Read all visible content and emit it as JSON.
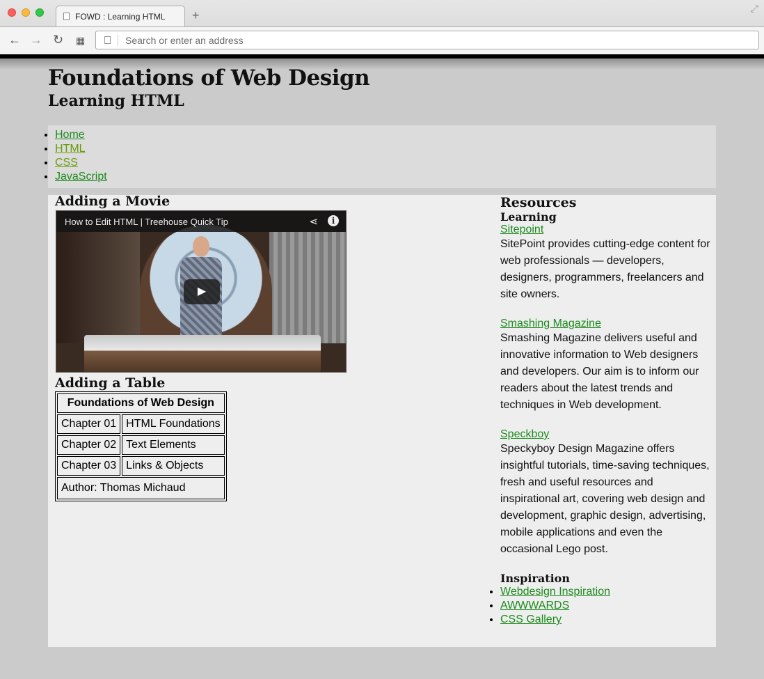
{
  "browser": {
    "tab_title": "FOWD : Learning HTML",
    "new_tab": "+",
    "address_placeholder": "Search or enter an address"
  },
  "site": {
    "title": "Foundations of Web Design",
    "subtitle": "Learning HTML"
  },
  "nav": {
    "items": [
      "Home",
      "HTML",
      "CSS",
      "JavaScript"
    ]
  },
  "main": {
    "movie_heading": "Adding a Movie",
    "video_title": "How to Edit HTML | Treehouse Quick Tip",
    "table_heading": "Adding a Table",
    "table": {
      "caption": "Foundations of Web Design",
      "rows": [
        [
          "Chapter 01",
          "HTML Foundations"
        ],
        [
          "Chapter 02",
          "Text Elements"
        ],
        [
          "Chapter 03",
          "Links & Objects"
        ]
      ],
      "footer": "Author: Thomas Michaud"
    }
  },
  "resources": {
    "heading": "Resources",
    "learning_heading": "Learning",
    "learning": [
      {
        "name": "Sitepoint",
        "desc": "SitePoint provides cutting-edge content for web professionals — developers, designers, programmers, freelancers and site owners."
      },
      {
        "name": "Smashing Magazine",
        "desc": "Smashing Magazine delivers useful and innovative information to Web designers and developers. Our aim is to inform our readers about the latest trends and techniques in Web development."
      },
      {
        "name": "Speckboy",
        "desc": "Speckyboy Design Magazine offers insightful tutorials, time-saving techniques, fresh and useful resources and inspirational art, covering web design and development, graphic design, advertising, mobile applications and even the occasional Lego post."
      }
    ],
    "inspiration_heading": "Inspiration",
    "inspiration": [
      "Webdesign Inspiration",
      "AWWWARDS",
      "CSS Gallery"
    ]
  },
  "colors": {
    "link": "#1c8a1c",
    "visited_link": "#6c9a0a",
    "page_bg": "#cbcbcb",
    "content_bg": "#eeeeee",
    "nav_bg": "#dcdcdc"
  }
}
